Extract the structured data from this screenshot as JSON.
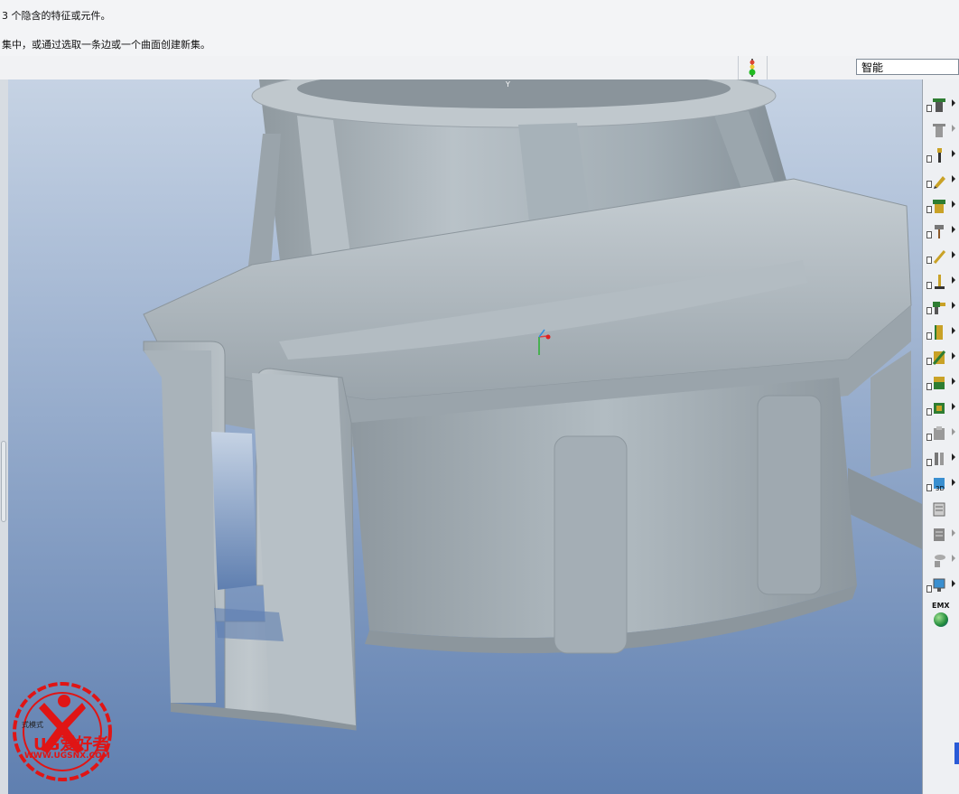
{
  "messages": {
    "line1": "3 个隐含的特征或元件。",
    "line2": "集中，或通过选取一条边或一个曲面创建新集。"
  },
  "status": {
    "filter_value": "智能"
  },
  "toolbar": {
    "emx_label": "EMX"
  },
  "watermark": {
    "brand": "UG爱好者",
    "url": "WWW.UGSNX.COM",
    "small_text": "式模式"
  },
  "colors": {
    "viewport_top": "#c6d3e4",
    "viewport_bottom": "#5f7fb0",
    "model": "#a9b3bb",
    "accent_red": "#e01515"
  }
}
